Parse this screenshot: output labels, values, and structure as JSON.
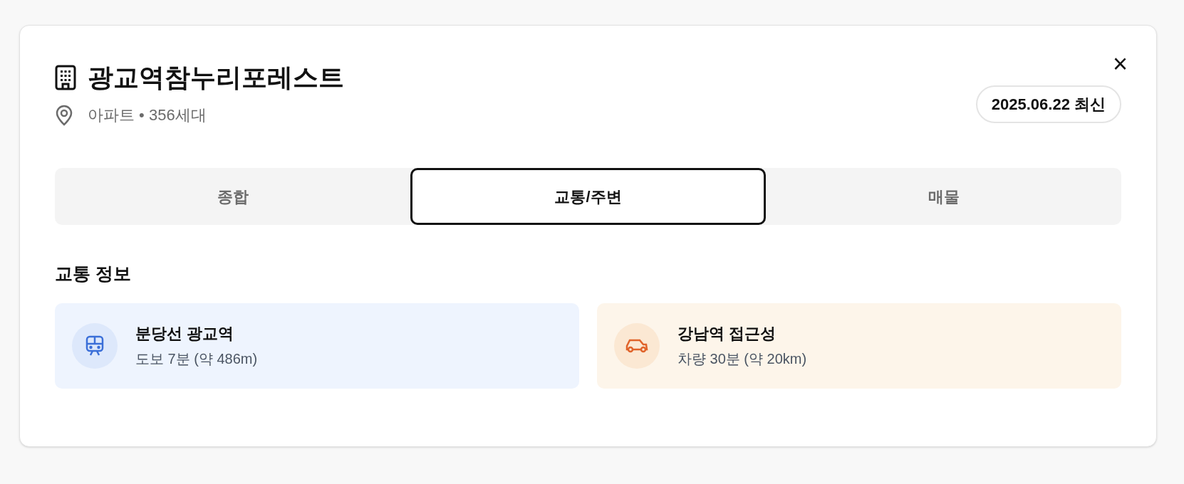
{
  "header": {
    "title": "광교역참누리포레스트",
    "subtitle": "아파트 • 356세대",
    "badge": "2025.06.22 최신",
    "close": "×"
  },
  "tabs": [
    {
      "label": "종합",
      "selected": false
    },
    {
      "label": "교통/주변",
      "selected": true
    },
    {
      "label": "매물",
      "selected": false
    }
  ],
  "section": {
    "title": "교통 정보"
  },
  "transport": [
    {
      "kind": "subway",
      "name": "분당선 광교역",
      "detail": "도보 7분 (약 486m)"
    },
    {
      "kind": "car",
      "name": "강남역 접근성",
      "detail": "차량 30분 (약 20km)"
    }
  ]
}
